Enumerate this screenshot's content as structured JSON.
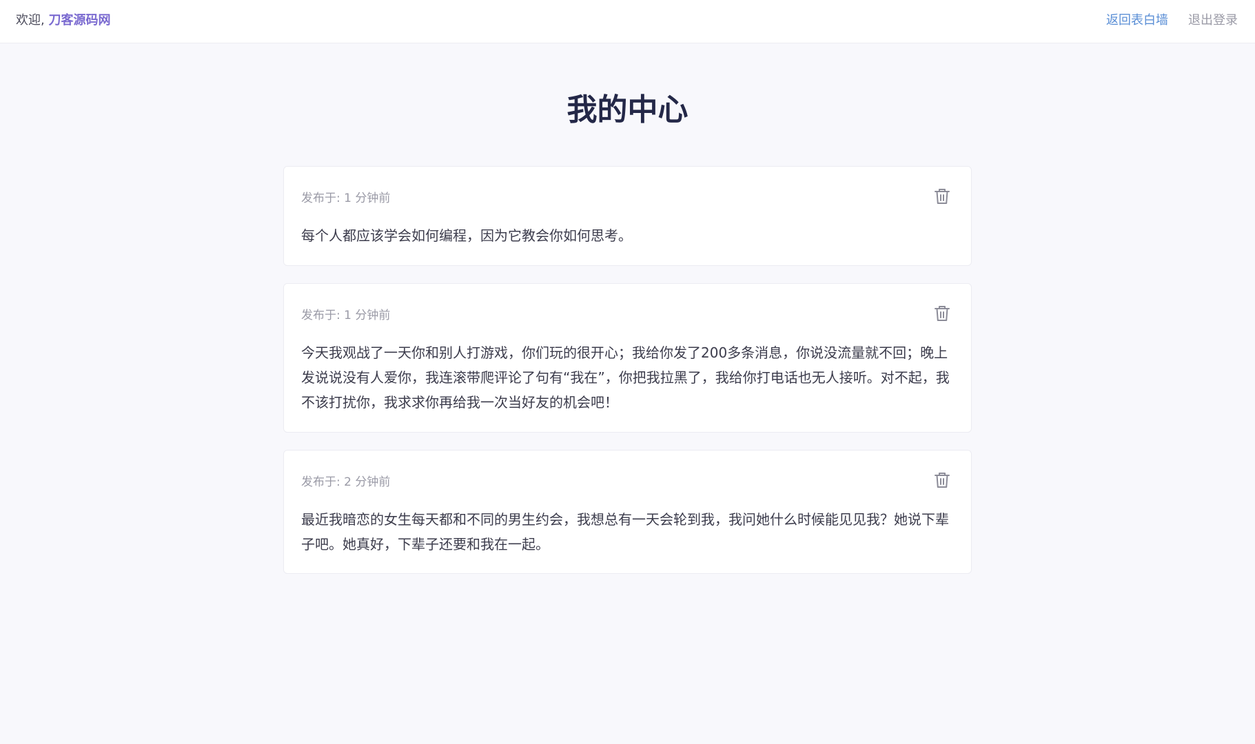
{
  "header": {
    "welcome_prefix": "欢迎, ",
    "username": "刀客源码网",
    "back_to_wall": "返回表白墙",
    "logout": "退出登录"
  },
  "page": {
    "title": "我的中心"
  },
  "posts": [
    {
      "meta": "发布于: 1 分钟前",
      "content": "每个人都应该学会如何编程，因为它教会你如何思考。"
    },
    {
      "meta": "发布于: 1 分钟前",
      "content": "今天我观战了一天你和别人打游戏，你们玩的很开心；我给你发了200多条消息，你说没流量就不回；晚上发说说没有人爱你，我连滚带爬评论了句有“我在”，你把我拉黑了，我给你打电话也无人接听。对不起，我不该打扰你，我求求你再给我一次当好友的机会吧！"
    },
    {
      "meta": "发布于: 2 分钟前",
      "content": "最近我暗恋的女生每天都和不同的男生约会，我想总有一天会轮到我，我问她什么时候能见见我？她说下辈子吧。她真好，下辈子还要和我在一起。"
    }
  ],
  "icons": {
    "delete": "trash-icon"
  },
  "colors": {
    "username": "#7a6ad0",
    "back_to_wall": "#5b8fd6",
    "logout": "#9a9aa6",
    "title": "#242848",
    "background": "#f8f8fc"
  }
}
